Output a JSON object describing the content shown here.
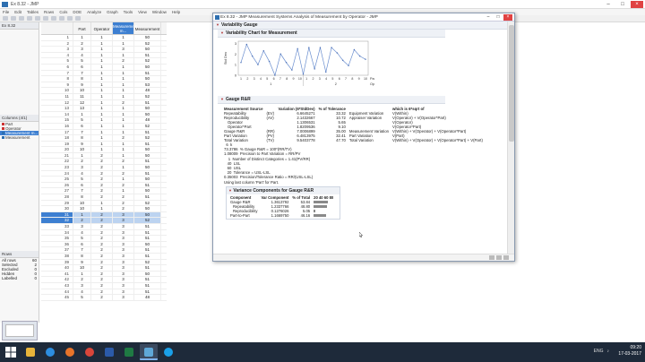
{
  "main_window": {
    "title": "Ex 8.32 - JMP",
    "menu": [
      "File",
      "Edit",
      "Tables",
      "Rows",
      "Cols",
      "DOE",
      "Analyze",
      "Graph",
      "Tools",
      "View",
      "Window",
      "Help"
    ]
  },
  "left_panel": {
    "table_name": "Ex 8.32",
    "columns_header": "Columns (4/1)",
    "columns": [
      {
        "name": "Part",
        "selected": false
      },
      {
        "name": "Operator",
        "selected": false
      },
      {
        "name": "Measurement m...",
        "selected": true
      },
      {
        "name": "Measurement",
        "selected": false
      }
    ],
    "rows_header": "Rows",
    "row_stats": [
      {
        "label": "All rows",
        "value": "60"
      },
      {
        "label": "Selected",
        "value": "2"
      },
      {
        "label": "Excluded",
        "value": "0"
      },
      {
        "label": "Hidden",
        "value": "0"
      },
      {
        "label": "Labelled",
        "value": "0"
      }
    ]
  },
  "data_table": {
    "headers": [
      "",
      "Part",
      "Operator",
      "Measurement m...",
      "Measurement"
    ],
    "rows": [
      [
        "1",
        "1",
        "1",
        "1",
        "50"
      ],
      [
        "2",
        "2",
        "1",
        "1",
        "52"
      ],
      [
        "3",
        "3",
        "1",
        "3",
        "50"
      ],
      [
        "4",
        "4",
        "1",
        "1",
        "51"
      ],
      [
        "5",
        "5",
        "1",
        "2",
        "52"
      ],
      [
        "6",
        "6",
        "1",
        "1",
        "50"
      ],
      [
        "7",
        "7",
        "1",
        "1",
        "51"
      ],
      [
        "8",
        "8",
        "1",
        "1",
        "50"
      ],
      [
        "9",
        "9",
        "1",
        "1",
        "53"
      ],
      [
        "10",
        "10",
        "1",
        "1",
        "48"
      ],
      [
        "11",
        "11",
        "1",
        "1",
        "52"
      ],
      [
        "12",
        "12",
        "1",
        "2",
        "51"
      ],
      [
        "13",
        "13",
        "1",
        "1",
        "50"
      ],
      [
        "14",
        "1",
        "1",
        "1",
        "50"
      ],
      [
        "15",
        "5",
        "1",
        "1",
        "48"
      ],
      [
        "16",
        "6",
        "1",
        "1",
        "52"
      ],
      [
        "17",
        "7",
        "1",
        "1",
        "51"
      ],
      [
        "18",
        "8",
        "1",
        "2",
        "52"
      ],
      [
        "19",
        "9",
        "1",
        "1",
        "51"
      ],
      [
        "20",
        "10",
        "1",
        "1",
        "50"
      ],
      [
        "21",
        "1",
        "2",
        "1",
        "50"
      ],
      [
        "22",
        "2",
        "2",
        "2",
        "51"
      ],
      [
        "23",
        "3",
        "2",
        "1",
        "50"
      ],
      [
        "24",
        "4",
        "2",
        "2",
        "51"
      ],
      [
        "25",
        "5",
        "2",
        "1",
        "50"
      ],
      [
        "26",
        "6",
        "2",
        "2",
        "51"
      ],
      [
        "27",
        "7",
        "2",
        "1",
        "50"
      ],
      [
        "28",
        "8",
        "2",
        "2",
        "51"
      ],
      [
        "29",
        "10",
        "1",
        "2",
        "52"
      ],
      [
        "30",
        "10",
        "1",
        "2",
        "50"
      ],
      [
        "31",
        "1",
        "2",
        "3",
        "50"
      ],
      [
        "32",
        "2",
        "2",
        "3",
        "52"
      ],
      [
        "33",
        "3",
        "2",
        "3",
        "51"
      ],
      [
        "34",
        "4",
        "2",
        "3",
        "51"
      ],
      [
        "35",
        "5",
        "2",
        "3",
        "51"
      ],
      [
        "36",
        "6",
        "2",
        "3",
        "50"
      ],
      [
        "37",
        "7",
        "2",
        "3",
        "51"
      ],
      [
        "38",
        "8",
        "2",
        "3",
        "51"
      ],
      [
        "39",
        "9",
        "2",
        "3",
        "52"
      ],
      [
        "40",
        "10",
        "2",
        "3",
        "51"
      ],
      [
        "41",
        "1",
        "2",
        "3",
        "50"
      ],
      [
        "42",
        "2",
        "2",
        "3",
        "51"
      ],
      [
        "43",
        "3",
        "2",
        "3",
        "51"
      ],
      [
        "44",
        "4",
        "2",
        "3",
        "51"
      ],
      [
        "45",
        "5",
        "2",
        "3",
        "48"
      ]
    ],
    "highlighted_rows": [
      30,
      31
    ]
  },
  "report": {
    "title": "Ex 8.32 - JMP Measurement Systems Analysis of Measurement by Operator - JMP",
    "section_variability": "Variability Gauge",
    "chart_title": "Variability Chart for Measurement",
    "chart_ylabel": "Std Dev",
    "chart_xlabel_part": "Part",
    "chart_xlabel_operator": "Operator",
    "section_grr": "Gauge R&R",
    "grr_headers": [
      "Measurement Source",
      "",
      "Variation (6*StdDev)",
      "% of Tolerance",
      "",
      "which is 6*sqrt of"
    ],
    "grr_rows": [
      {
        "src": "Repeatability",
        "code": "(EV)",
        "var": "6.6645271",
        "tol": "33.32",
        "desc": "Equipment Variation",
        "formula": "V(Within)",
        "indent": false
      },
      {
        "src": "Reproducibility",
        "code": "(AV)",
        "var": "2.1432667",
        "tol": "10.72",
        "desc": "Appraiser Variation",
        "formula": "V(Operator) + V(Operator*Part)",
        "indent": false
      },
      {
        "src": "Operator",
        "code": "",
        "var": "1.1306531",
        "tol": "5.65",
        "desc": "",
        "formula": "V(Operator)",
        "indent": true
      },
      {
        "src": "Operator*Part",
        "code": "",
        "var": "1.8209536",
        "tol": "9.10",
        "desc": "",
        "formula": "V(Operator*Part)",
        "indent": true
      },
      {
        "src": "Gauge R&R",
        "code": "(RR)",
        "var": "7.0006899",
        "tol": "35.00",
        "desc": "Measurement Variation",
        "formula": "V(Within) + V(Operator) + V(Operator*Part)",
        "indent": false
      },
      {
        "src": "Part Variation",
        "code": "(PV)",
        "var": "6.4813975",
        "tol": "32.41",
        "desc": "Part Variation",
        "formula": "V(Part)",
        "indent": false
      },
      {
        "src": "Total Variation",
        "code": "(TV)",
        "var": "9.5403778",
        "tol": "47.70",
        "desc": "Total Variation",
        "formula": "V(Within) + V(Operator) + V(Operator*Part) + V(Part)",
        "indent": false
      }
    ],
    "grr_text": [
      "  6  k",
      "73.3786  % Gauge R&R = 100*(RR/TV)",
      "1.08009  Precision to Part Variation = RR/PV",
      "    1  Number of Distinct Categories = 1.41(PV/RR)",
      "   40  LSL",
      "   60  USL",
      "   20  Tolerance = USL-LSL",
      "0.35003  Precision/Tolerance Ratio = RR/(USL-LSL)",
      "Using last column 'Part' for Part."
    ],
    "vc_title": "Variance Components for Gauge R&R",
    "vc_headers": [
      "Component",
      "Var Component",
      "% of Total",
      "20 40 60 80"
    ],
    "vc_rows": [
      {
        "comp": "Gauge R&R",
        "var": "1.3613792",
        "pct": "53.84",
        "pctnum": 53.84,
        "indent": false
      },
      {
        "comp": "Repeatability",
        "var": "1.2337766",
        "pct": "48.80",
        "pctnum": 48.8,
        "indent": true
      },
      {
        "comp": "Reproducibility",
        "var": "0.1276026",
        "pct": "5.05",
        "pctnum": 5.05,
        "indent": true
      },
      {
        "comp": "Part-to-Part",
        "var": "1.1669750",
        "pct": "46.16",
        "pctnum": 46.16,
        "indent": false
      }
    ]
  },
  "chart_data": {
    "type": "line",
    "ylabel": "Std Dev",
    "xlabel": "Part",
    "x_parts": [
      "1",
      "2",
      "3",
      "4",
      "5",
      "6",
      "7",
      "8",
      "9",
      "10",
      "1",
      "2",
      "3",
      "4",
      "5",
      "6",
      "7",
      "8",
      "9",
      "10"
    ],
    "x_operators": [
      "1",
      "2"
    ],
    "values": [
      1.2,
      2.9,
      1.8,
      1.0,
      2.3,
      1.3,
      0.0,
      2.0,
      1.2,
      0.5,
      2.5,
      0.1,
      2.6,
      0.6,
      2.6,
      0.3,
      2.6,
      2.1,
      1.4,
      0.9,
      2.4,
      1.8,
      1.5
    ],
    "y_ticks": [
      "3",
      "2",
      "1",
      "0"
    ],
    "ylim": [
      0,
      3.2
    ]
  },
  "taskbar": {
    "time": "09:20",
    "date": "17-03-2017",
    "lang": "ENG"
  }
}
